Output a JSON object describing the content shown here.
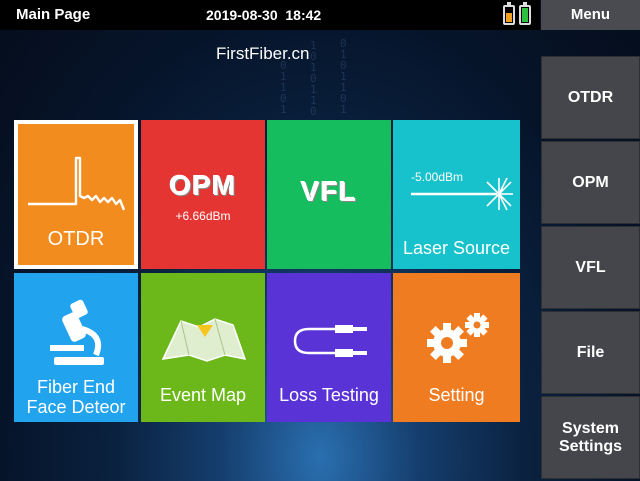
{
  "status_bar": {
    "title": "Main Page",
    "datetime": "2019-08-30  18:42",
    "battery_colors": [
      "#f0a020",
      "#30c040"
    ]
  },
  "brand": "FirstFiber.cn",
  "tiles": [
    {
      "id": "otdr",
      "label": "OTDR",
      "icon": "otdr-trace-icon",
      "color": "#f28c1f",
      "selected": true
    },
    {
      "id": "opm",
      "label": "OPM",
      "sublabel": "+6.66dBm",
      "color": "#e53533"
    },
    {
      "id": "vfl",
      "label": "VFL",
      "color": "#15bd5f"
    },
    {
      "id": "laser",
      "label": "Laser Source",
      "sublabel": "-5.00dBm",
      "icon": "laser-beam-icon",
      "color": "#17c2cc"
    },
    {
      "id": "fiber",
      "label_line1": "Fiber End",
      "label_line2": "Face Deteor",
      "icon": "microscope-icon",
      "color": "#21a3ee"
    },
    {
      "id": "eventmap",
      "label": "Event Map",
      "icon": "map-icon",
      "color": "#6cb81a"
    },
    {
      "id": "loss",
      "label": "Loss Testing",
      "icon": "fiber-cable-icon",
      "color": "#5a33d6"
    },
    {
      "id": "setting",
      "label": "Setting",
      "icon": "gears-icon",
      "color": "#f07c22"
    }
  ],
  "menu": {
    "header": "Menu",
    "items": [
      {
        "label": "OTDR"
      },
      {
        "label": "OPM"
      },
      {
        "label": "VFL"
      },
      {
        "label": "File"
      },
      {
        "label_line1": "System",
        "label_line2": "Settings"
      }
    ]
  }
}
